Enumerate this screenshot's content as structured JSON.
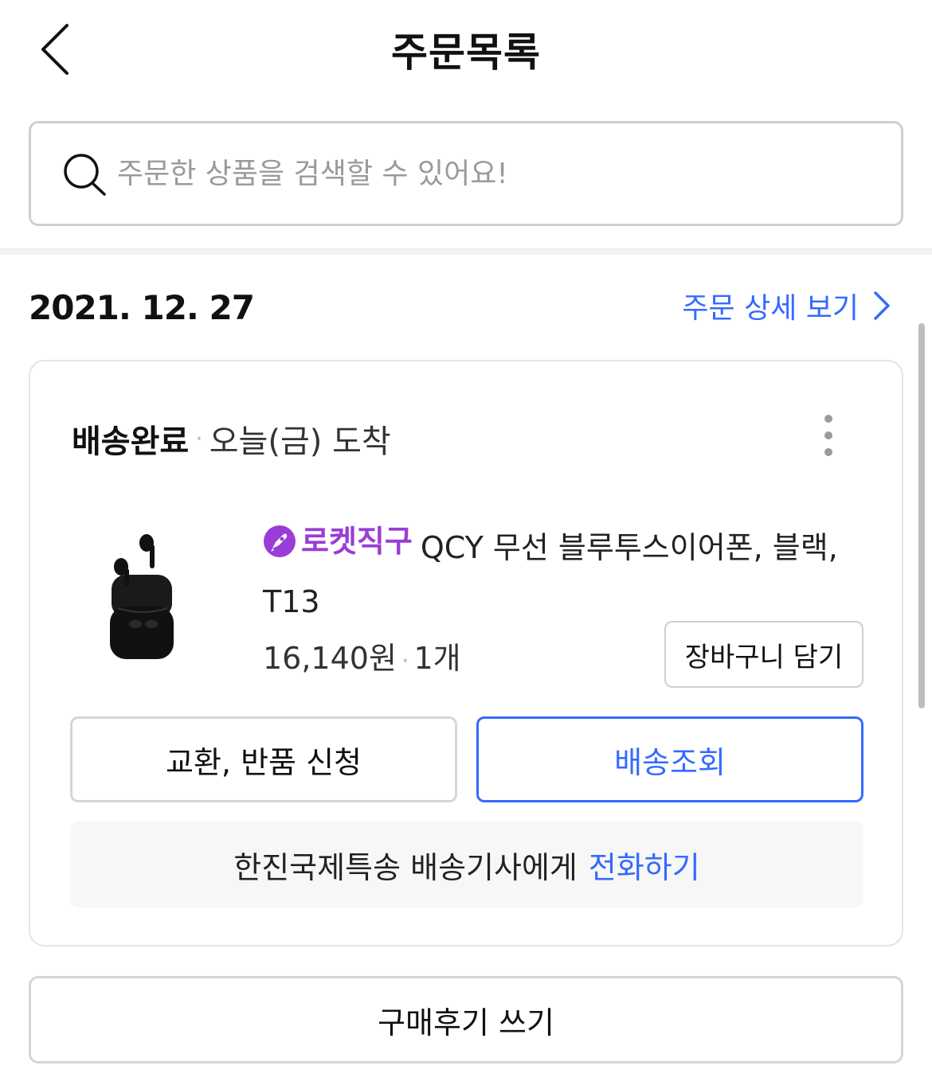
{
  "header": {
    "title": "주문목록",
    "back_icon": "chevron-left-icon"
  },
  "search": {
    "placeholder": "주문한 상품을 검색할 수 있어요!",
    "value": "",
    "icon": "search-icon"
  },
  "order": {
    "date": "2021. 12. 27",
    "detail_link_label": "주문 상세 보기",
    "status": "배송완료",
    "arrival": "오늘(금) 도착",
    "product": {
      "badge": "로켓직구",
      "name": "QCY 무선 블루투스이어폰, 블랙, T13",
      "price": "16,140원",
      "quantity": "1개",
      "cart_button": "장바구니 담기"
    },
    "buttons": {
      "return_label": "교환, 반품 신청",
      "track_label": "배송조회"
    },
    "contact": {
      "text": "한진국제특송 배송기사에게",
      "link": "전화하기"
    }
  },
  "review_button": "구매후기 쓰기",
  "colors": {
    "accent_blue": "#346aff",
    "rocket_purple": "#9a3cd6",
    "border_gray": "#d6d6d6"
  }
}
